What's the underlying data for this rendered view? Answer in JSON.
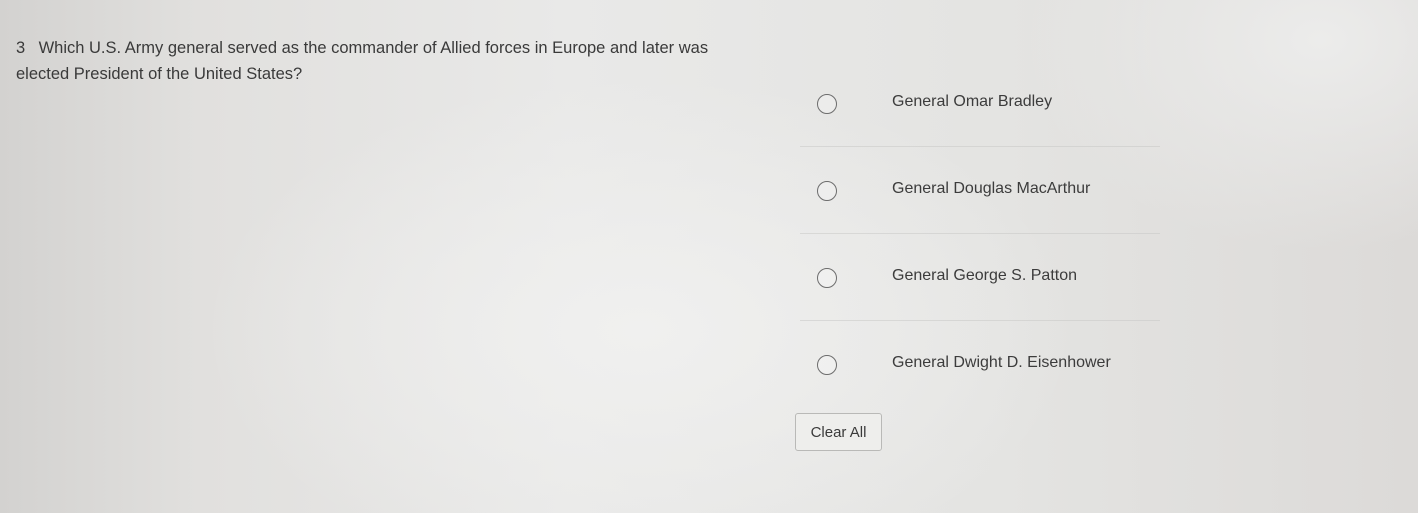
{
  "question": {
    "number": "3",
    "text": "Which U.S. Army general served as the commander of Allied forces in Europe and later was elected President of the United States?"
  },
  "options": [
    {
      "label": "General Omar Bradley",
      "selected": false
    },
    {
      "label": "General Douglas MacArthur",
      "selected": false
    },
    {
      "label": "General George S. Patton",
      "selected": false
    },
    {
      "label": "General Dwight D. Eisenhower",
      "selected": false
    }
  ],
  "clear_button": {
    "label": "Clear All"
  }
}
